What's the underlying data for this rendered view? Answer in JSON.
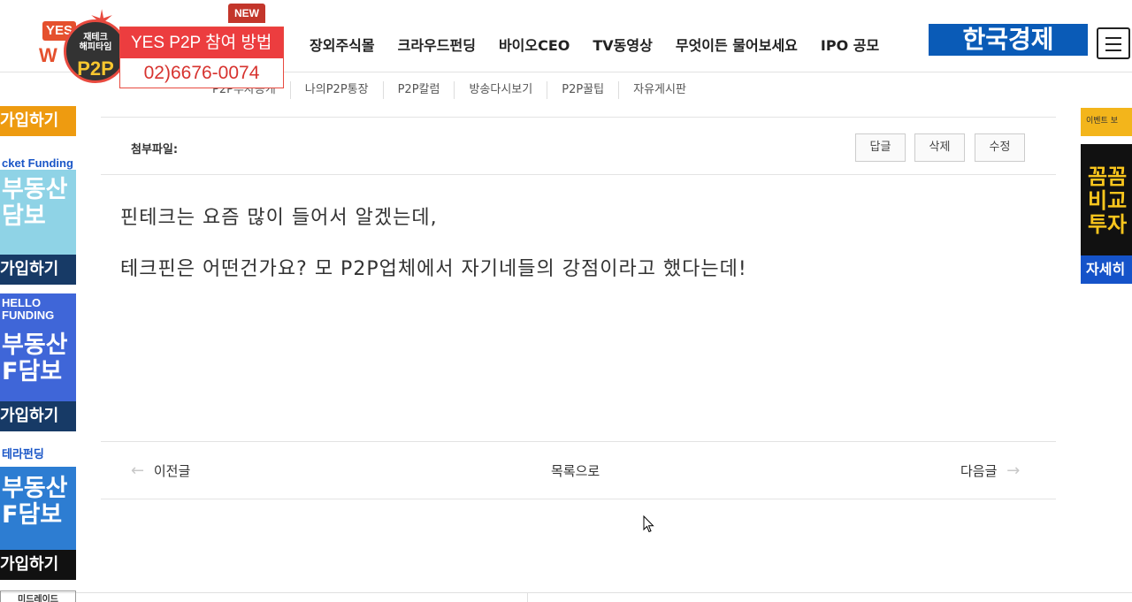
{
  "promo": {
    "yes": "YES",
    "w": "W",
    "circle_small": "재테크\n해피타임",
    "p2p": "P2P",
    "title": "YES P2P 참여 방법",
    "phone": "02)6676-0074",
    "new_tag": "NEW"
  },
  "gnb": [
    "장외주식몰",
    "크라우드펀딩",
    "바이오CEO",
    "TV동영상",
    "무엇이든 물어보세요",
    "IPO 공모"
  ],
  "logo_text": "한국경제",
  "subnav": [
    "P2P투자공개",
    "나의P2P통장",
    "P2P칼럼",
    "방송다시보기",
    "P2P꿀팁",
    "자유게시판"
  ],
  "left_ads": [
    {
      "brand": "",
      "body": "",
      "cta": "가입하기"
    },
    {
      "brand": "cket Funding",
      "body": "부동산\n담보",
      "cta": "가입하기"
    },
    {
      "brand": "HELLO\nFUNDING",
      "body": "부동산\nF담보",
      "cta": "가입하기"
    },
    {
      "brand": "테라펀딩",
      "body": "부동산\nF담보",
      "cta": "가입하기"
    }
  ],
  "right_ads": {
    "top_text": "이벤트 보",
    "big": "꼼꼼\n비교\n투자",
    "cta": "자세히"
  },
  "post": {
    "attach_label": "첨부파일:",
    "buttons": {
      "reply": "답글",
      "delete": "삭제",
      "edit": "수정"
    },
    "lines": [
      "핀테크는 요즘 많이 들어서 알겠는데,",
      "테크핀은 어떤건가요? 모 P2P업체에서 자기네들의 강점이라고 했다는데!"
    ],
    "nav": {
      "prev": "이전글",
      "list": "목록으로",
      "next": "다음글"
    }
  },
  "footer_left": "미드레이드"
}
